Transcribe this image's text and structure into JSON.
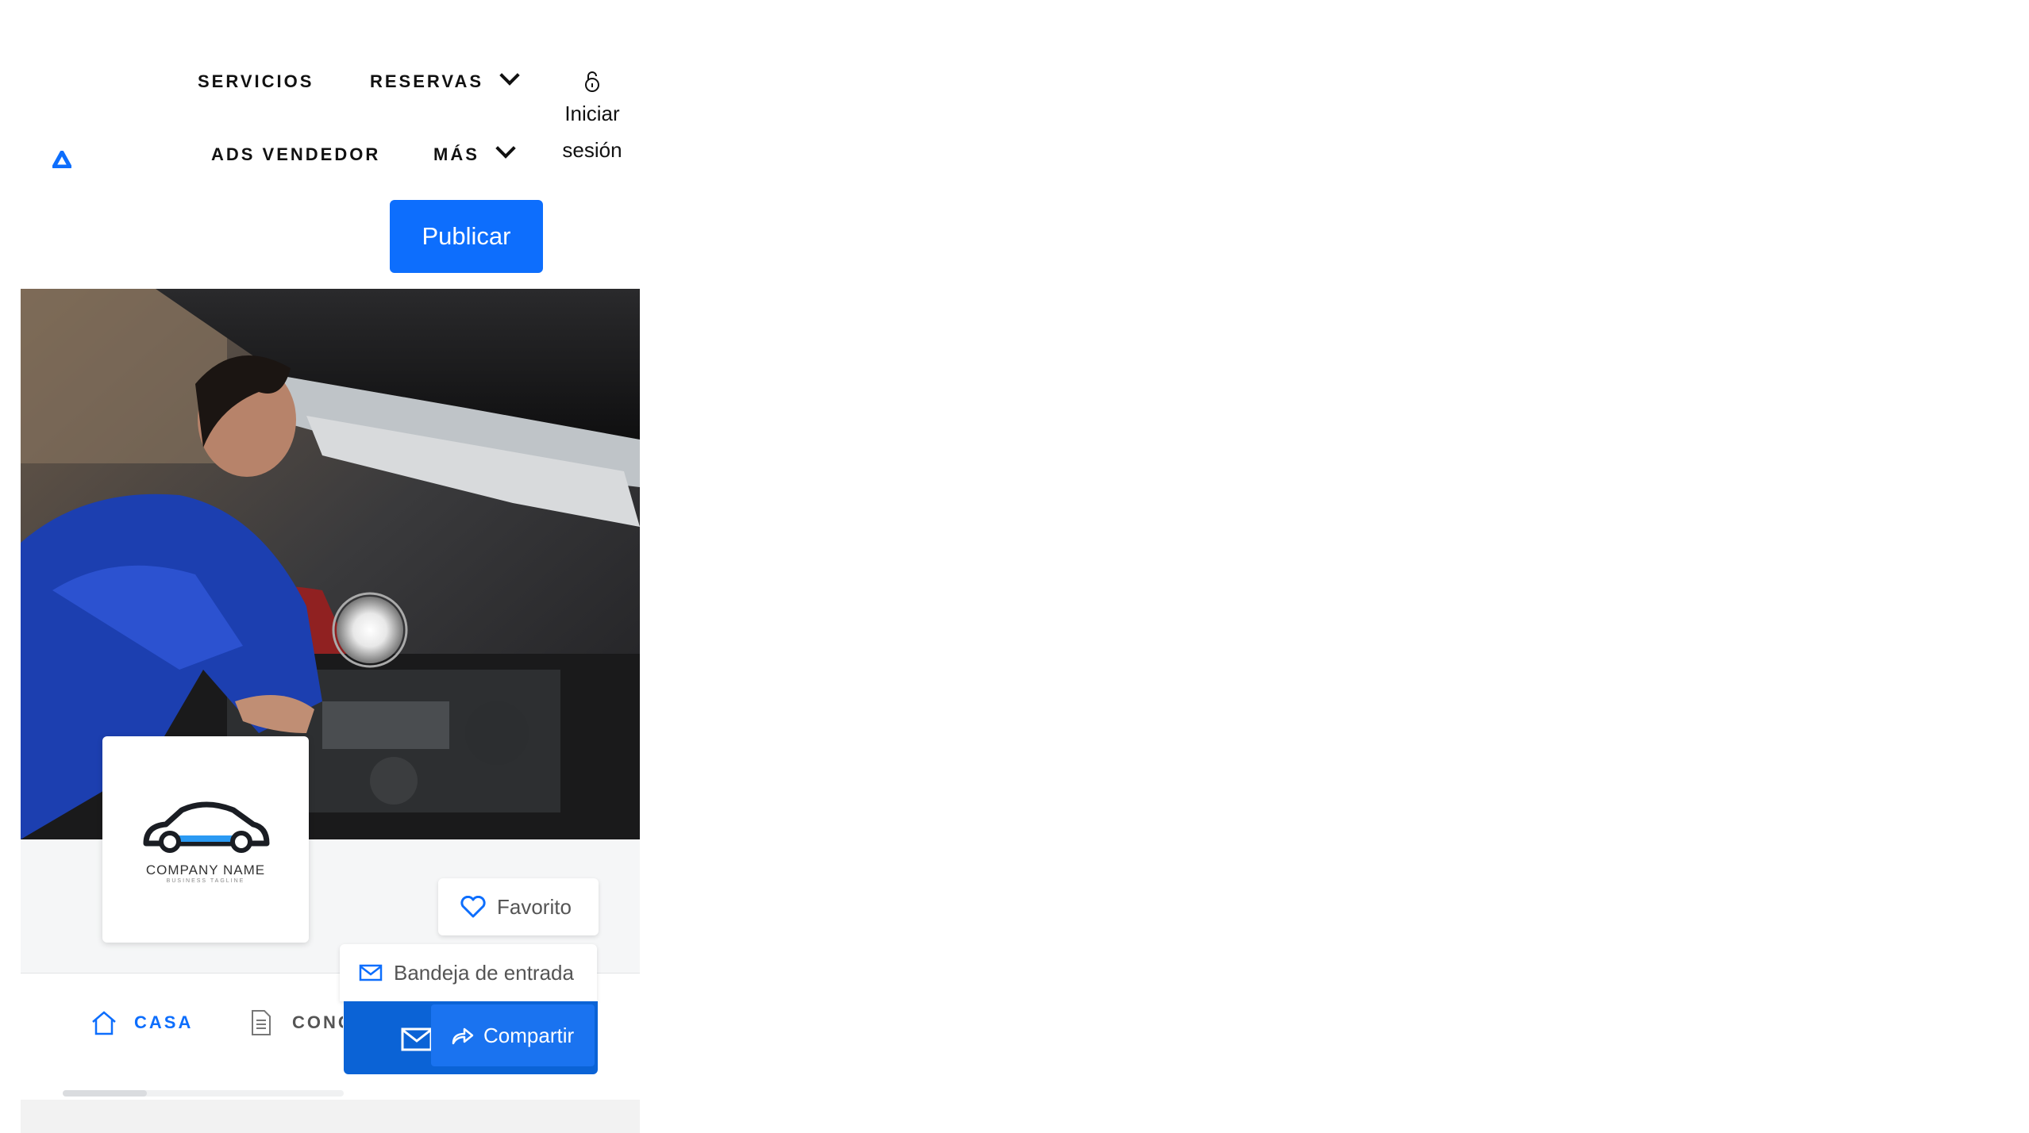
{
  "nav": {
    "services": "SERVICIOS",
    "bookings": "RESERVAS",
    "seller_ads": "ADS VENDEDOR",
    "more": "MÁS",
    "login_line1": "Iniciar",
    "login_line2": "sesión",
    "publish": "Publicar"
  },
  "brand": {
    "accent": "#0d6efd",
    "logo_icon": "triangle-logo-icon"
  },
  "profile": {
    "company_logo_text": "COMPANY NAME",
    "company_tagline": "BUSINESS TAGLINE",
    "favorite": "Favorito",
    "inbox": "Bandeja de entrada",
    "share": "Compartir"
  },
  "tabs": [
    {
      "label": "CASA",
      "icon": "home-icon",
      "active": true
    },
    {
      "label": "CONC",
      "icon": "document-icon",
      "active": false
    }
  ]
}
